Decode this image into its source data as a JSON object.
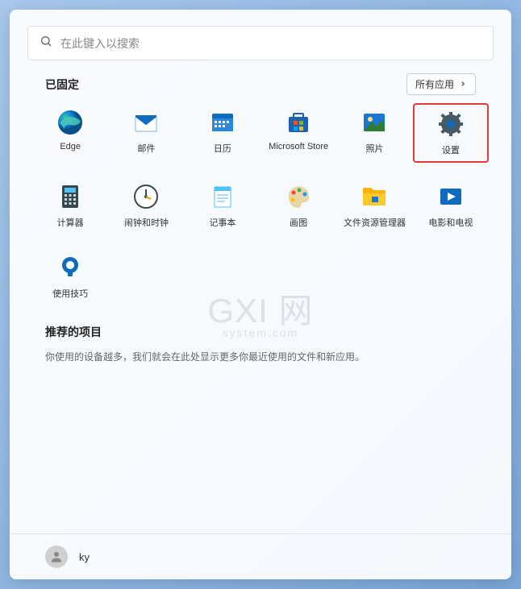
{
  "search": {
    "placeholder": "在此键入以搜索"
  },
  "pinned": {
    "title": "已固定",
    "all_apps_label": "所有应用",
    "apps": [
      {
        "label": "Edge"
      },
      {
        "label": "邮件"
      },
      {
        "label": "日历"
      },
      {
        "label": "Microsoft Store"
      },
      {
        "label": "照片"
      },
      {
        "label": "设置"
      },
      {
        "label": "计算器"
      },
      {
        "label": "闹钟和时钟"
      },
      {
        "label": "记事本"
      },
      {
        "label": "画图"
      },
      {
        "label": "文件资源管理器"
      },
      {
        "label": "电影和电视"
      },
      {
        "label": "使用技巧"
      }
    ]
  },
  "recommended": {
    "title": "推荐的项目",
    "empty_text": "你使用的设备越多，我们就会在此处显示更多你最近使用的文件和新应用。"
  },
  "user": {
    "name": "ky"
  },
  "watermark": {
    "main": "GXI 网",
    "sub": "system.com"
  }
}
